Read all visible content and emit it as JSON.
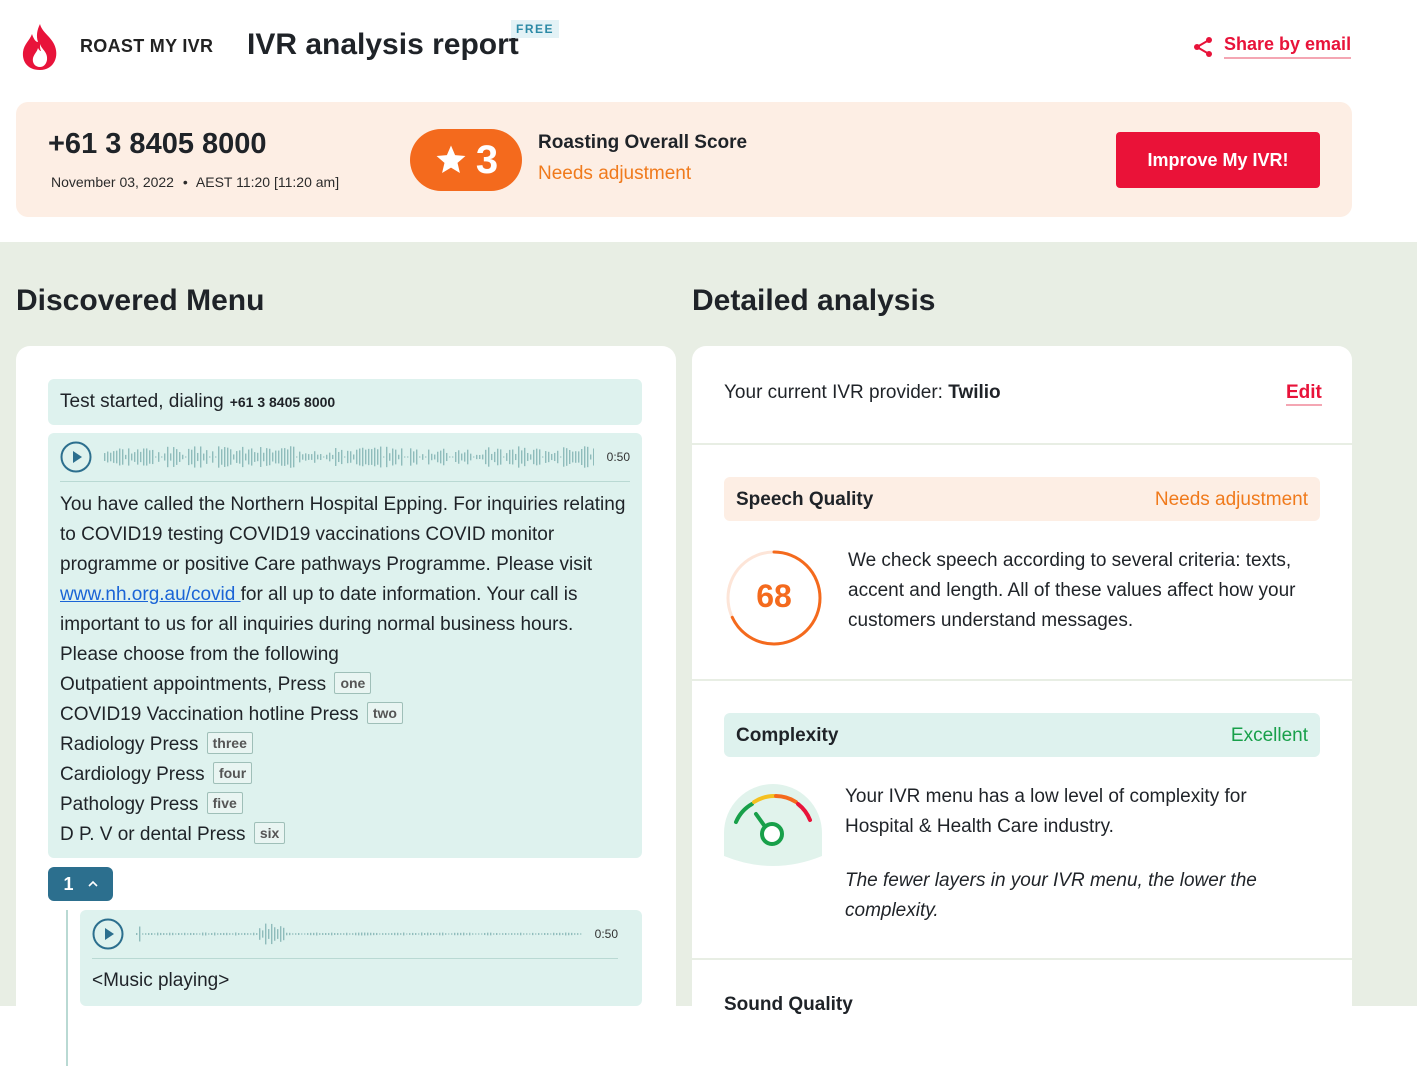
{
  "header": {
    "brand": "ROAST MY IVR",
    "title": "IVR analysis report",
    "badge": "FREE",
    "share_label": "Share by email",
    "icons": {
      "logo": "flame-logo-icon",
      "share": "share-icon"
    }
  },
  "score_card": {
    "phone": "+61 3 8405 8000",
    "date": "November 03, 2022",
    "separator": "•",
    "time": "AEST 11:20 [11:20 am]",
    "score": "3",
    "score_label": "Roasting Overall Score",
    "score_status": "Needs adjustment",
    "improve_button": "Improve My IVR!"
  },
  "discovered_menu": {
    "title": "Discovered Menu",
    "test_started": "Test started, dialing",
    "test_number": "+61 3 8405 8000",
    "prompt": {
      "duration": "0:50",
      "text_before_link": "You have called the Northern Hospital Epping. For inquiries relating to COVID19 testing COVID19 vaccinations COVID monitor programme or positive Care pathways Programme. Please visit ",
      "link": "www.nh.org.au/covid ",
      "text_after_link": "for all up to date information. Your call is important to us for all inquiries during normal business hours.",
      "choose": "Please choose from the following",
      "options": [
        {
          "label": "Outpatient appointments, Press",
          "key": "one"
        },
        {
          "label": "COVID19 Vaccination hotline Press",
          "key": "two"
        },
        {
          "label": "Radiology Press",
          "key": "three"
        },
        {
          "label": "Cardiology Press",
          "key": "four"
        },
        {
          "label": "Pathology Press",
          "key": "five"
        },
        {
          "label": "D P. V or dental Press",
          "key": "six"
        }
      ]
    },
    "branch": {
      "number": "1",
      "duration": "0:50",
      "text": "<Music playing>"
    }
  },
  "detailed_analysis": {
    "title": "Detailed analysis",
    "provider_label": "Your current IVR provider:",
    "provider_name": "Twilio",
    "edit": "Edit",
    "speech_quality": {
      "name": "Speech Quality",
      "status": "Needs adjustment",
      "score": "68",
      "score_value": 68,
      "description": "We check speech according to several criteria: texts, accent and length. All of these values affect how your customers understand messages."
    },
    "complexity": {
      "name": "Complexity",
      "status": "Excellent",
      "description": "Your IVR menu has a low level of complexity for Hospital & Health Care industry.",
      "note": "The fewer layers in your IVR menu, the lower the complexity."
    },
    "sound_quality_title": "Sound Quality"
  },
  "colors": {
    "accent_red": "#ea1238",
    "orange": "#f46a1d",
    "green": "#18a04a",
    "teal": "#2c6f8e"
  }
}
